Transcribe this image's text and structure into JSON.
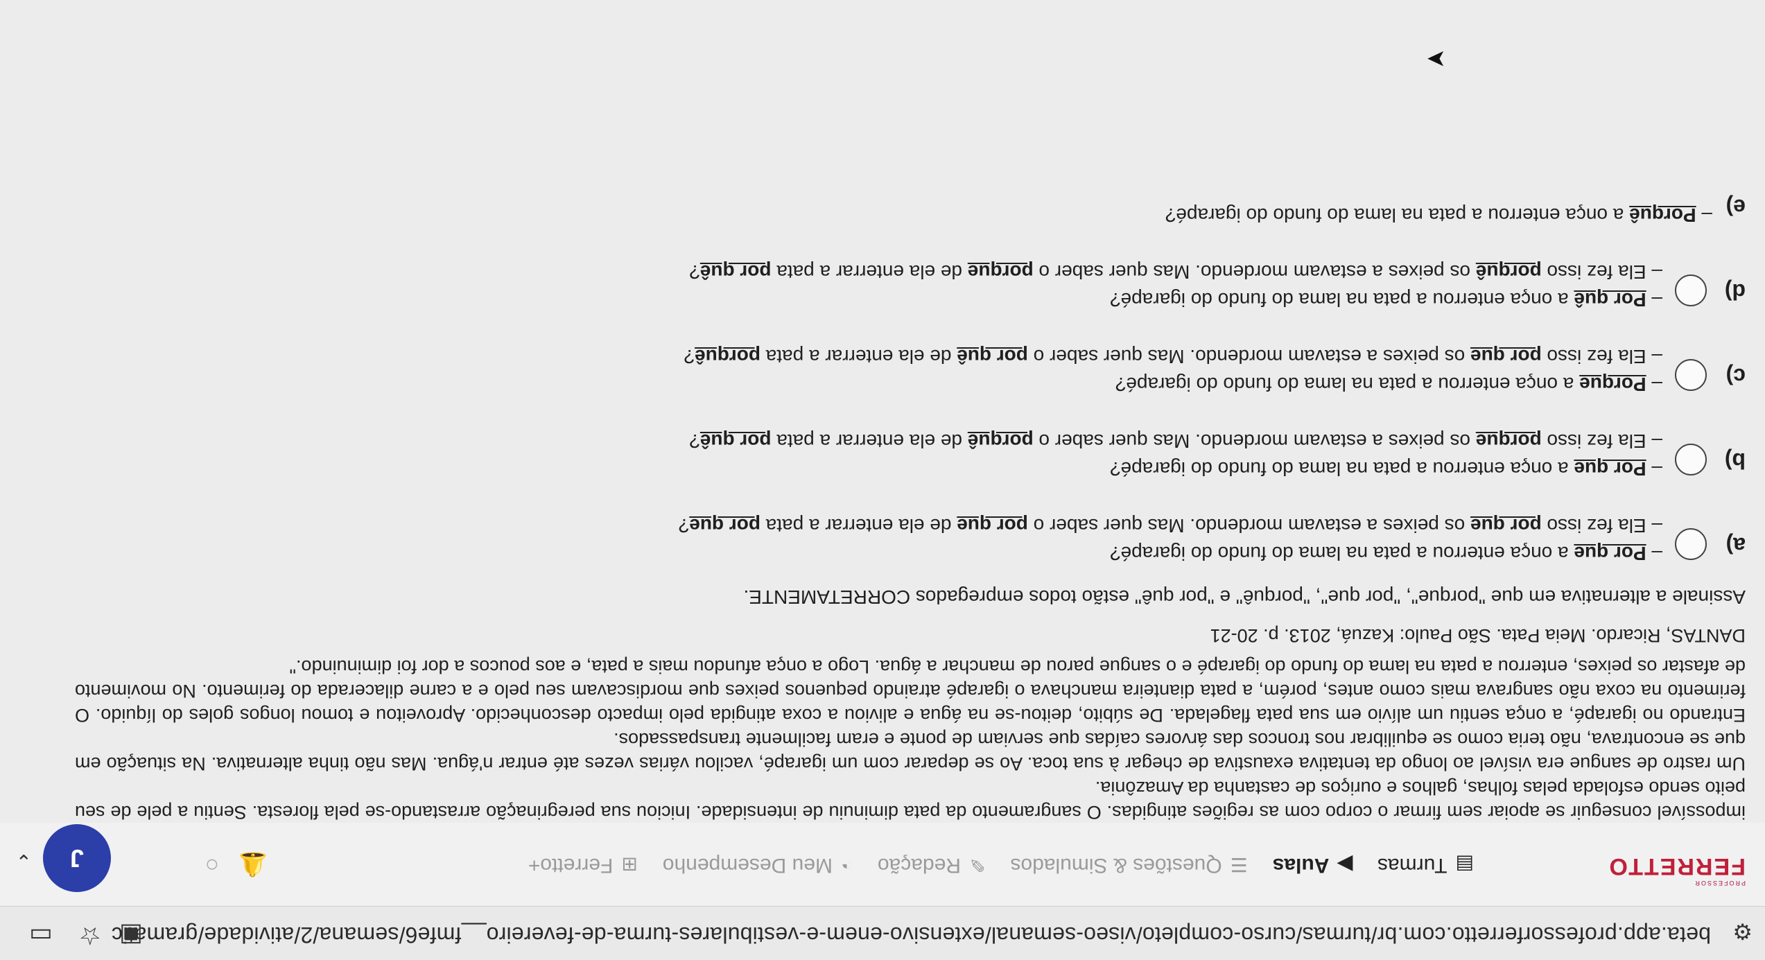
{
  "browser": {
    "url": "beta.app.professorferretto.com.br/turmas/curso-completo/viseo-semanal/extensivo-enem-e-vestibulares-turma-de-fevereiro__fmfe6/semana/2/atividade/gramatic",
    "icons": [
      "tune-icon",
      "extensions-icon",
      "star-icon",
      "tab-icon"
    ]
  },
  "app": {
    "logo_prefix": "PROFESSOR",
    "logo": "FERRETTO",
    "nav": [
      {
        "label": "Turmas",
        "icon": "turmas-icon"
      },
      {
        "label": "Aulas",
        "icon": "aulas-icon"
      },
      {
        "label": "Questões & Simulados",
        "icon": "list-icon"
      },
      {
        "label": "Redação",
        "icon": "pen-icon"
      },
      {
        "label": "Meu Desempenho",
        "icon": "chart-icon"
      },
      {
        "label": "Ferretto+",
        "icon": "plus-box-icon"
      }
    ],
    "avatar_initial": "J"
  },
  "question": {
    "text_p1": "impossível conseguir se apoiar sem firmar o corpo com as regiões atingidas. O sangramento da pata diminuiu de intensidade. Iniciou sua peregrinação arrastando-se pela floresta. Sentiu a pele de seu peito sendo esfolada pelas folhas, galhos e ouriços de castanha da Amazônia.",
    "text_p2": "Um rastro de sangue era visível ao longo da tentativa exaustiva de chegar à sua toca. Ao se deparar com um igarapé, vacilou várias vezes até entrar n'água. Mas não tinha alternativa. Na situação em que se encontrava, não teria como se equilibrar nos troncos das árvores caídas que serviam de ponte e eram facilmente transpassados.",
    "text_p3": "Entrando no igarapé, a onça sentiu um alívio em sua pata flagelada. De súbito, deitou-se na água e aliviou a coxa atingida pelo impacto desconhecido. Aproveitou e tomou longos goles do líquido. O ferimento na coxa não sangrava mais como antes, porém, a pata dianteira manchava o igarapé atraindo pequenos peixes que mordiscavam seu pelo e a carne dilacerada do ferimento. No movimento de afastar os peixes, enterrou a pata na lama do fundo do igarapé e o sangue parou de manchar a água. Logo a onça afundou mais a pata, e aos poucos a dor foi diminuindo.\"",
    "source": "DANTAS, Ricardo. Meia Pata. São Paulo: Kazuá, 2013. p. 20-21",
    "instruction": "Assinale a alternativa em que \"porque\", \"por que\", \"porquê\" e \"por quê\" estão todos empregados CORRETAMENTE.",
    "options": [
      {
        "letter": "a)",
        "l1": [
          {
            "t": "– "
          },
          {
            "t": "Por que",
            "k": true
          },
          {
            "t": " a onça enterrou a pata na lama do fundo do igarapé?"
          }
        ],
        "l2": [
          {
            "t": "– Ela fez isso "
          },
          {
            "t": "por que",
            "k": true
          },
          {
            "t": " os peixes a estavam mordendo. Mas quer saber o "
          },
          {
            "t": "por que",
            "k": true
          },
          {
            "t": " de ela enterrar a pata "
          },
          {
            "t": "por que",
            "k": true
          },
          {
            "t": "?"
          }
        ]
      },
      {
        "letter": "b)",
        "l1": [
          {
            "t": "– "
          },
          {
            "t": "Por que",
            "k": true
          },
          {
            "t": " a onça enterrou a pata na lama do fundo do igarapé?"
          }
        ],
        "l2": [
          {
            "t": "– Ela fez isso "
          },
          {
            "t": "porque",
            "k": true
          },
          {
            "t": " os peixes a estavam mordendo. Mas quer saber o "
          },
          {
            "t": "porquê",
            "k": true
          },
          {
            "t": " de ela enterrar a pata "
          },
          {
            "t": "por quê",
            "k": true
          },
          {
            "t": "?"
          }
        ]
      },
      {
        "letter": "c)",
        "l1": [
          {
            "t": "– "
          },
          {
            "t": "Porque",
            "k": true
          },
          {
            "t": " a onça enterrou a pata na lama do fundo do igarapé?"
          }
        ],
        "l2": [
          {
            "t": "– Ela fez isso "
          },
          {
            "t": "por que",
            "k": true
          },
          {
            "t": " os peixes a estavam mordendo. Mas quer saber o "
          },
          {
            "t": "por quê",
            "k": true
          },
          {
            "t": " de ela enterrar a pata "
          },
          {
            "t": "porquê",
            "k": true
          },
          {
            "t": "?"
          }
        ]
      },
      {
        "letter": "d)",
        "l1": [
          {
            "t": "– "
          },
          {
            "t": "Por quê",
            "k": true
          },
          {
            "t": " a onça enterrou a pata na lama do fundo do igarapé?"
          }
        ],
        "l2": [
          {
            "t": "– Ela fez isso "
          },
          {
            "t": "porquê",
            "k": true
          },
          {
            "t": " os peixes a estavam mordendo. Mas quer saber o "
          },
          {
            "t": "porque",
            "k": true
          },
          {
            "t": " de ela enterrar a pata "
          },
          {
            "t": "por quê",
            "k": true
          },
          {
            "t": "?"
          }
        ]
      },
      {
        "letter": "e)",
        "l1": [
          {
            "t": "– "
          },
          {
            "t": "Porquê",
            "k": true
          },
          {
            "t": " a onça enterrou a pata na lama do fundo do igarapé?"
          }
        ]
      }
    ]
  }
}
